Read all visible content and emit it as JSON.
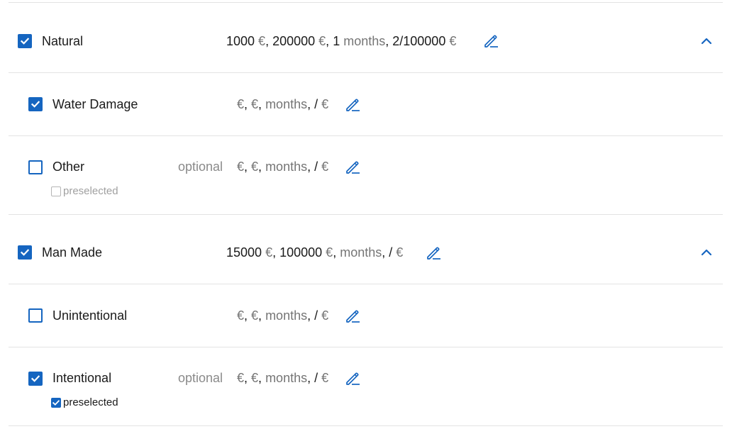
{
  "groups": {
    "natural": {
      "label": "Natural",
      "checked": true,
      "summary": {
        "v1": "1000",
        "u1": " €",
        "s1": ", ",
        "v2": "200000",
        "u2": " €",
        "s2": ", ",
        "v3": "1",
        "u3": " months",
        "s3": ", ",
        "v4": "2/100000",
        "u4": " €"
      },
      "icons": {
        "edit": "pencil-icon",
        "collapse": "chevron-up-icon"
      }
    },
    "man_made": {
      "label": "Man Made",
      "checked": true,
      "summary": {
        "v1": "15000",
        "u1": " €",
        "s1": ", ",
        "v2": "100000",
        "u2": " €",
        "s2": ", ",
        "u3": "months",
        "s3": ", ",
        "v4": "/",
        "u4": " €"
      },
      "icons": {
        "edit": "pencil-icon",
        "collapse": "chevron-up-icon"
      }
    }
  },
  "items": {
    "water_damage": {
      "label": "Water Damage",
      "checked": true,
      "summary": {
        "u1": "€",
        "s1": ", ",
        "u2": "€",
        "s2": ", ",
        "u3": "months",
        "s3": ", ",
        "v4": "/",
        "u4": " €"
      }
    },
    "other": {
      "label": "Other",
      "checked": false,
      "optional": "optional",
      "preselected": {
        "label": "preselected",
        "checked": false
      },
      "summary": {
        "u1": "€",
        "s1": ", ",
        "u2": "€",
        "s2": ", ",
        "u3": "months",
        "s3": ", ",
        "v4": "/",
        "u4": " €"
      }
    },
    "unintentional": {
      "label": "Unintentional",
      "checked": false,
      "summary": {
        "u1": "€",
        "s1": ", ",
        "u2": "€",
        "s2": ", ",
        "u3": "months",
        "s3": ", ",
        "v4": "/",
        "u4": " €"
      }
    },
    "intentional": {
      "label": "Intentional",
      "checked": true,
      "optional": "optional",
      "preselected": {
        "label": "preselected",
        "checked": true
      },
      "summary": {
        "u1": "€",
        "s1": ", ",
        "u2": "€",
        "s2": ", ",
        "u3": "months",
        "s3": ", ",
        "v4": "/",
        "u4": " €"
      }
    }
  },
  "colors": {
    "accent": "#1565c0",
    "text": "#1a1a1a",
    "muted": "#757575",
    "divider": "#e3e3e3"
  }
}
